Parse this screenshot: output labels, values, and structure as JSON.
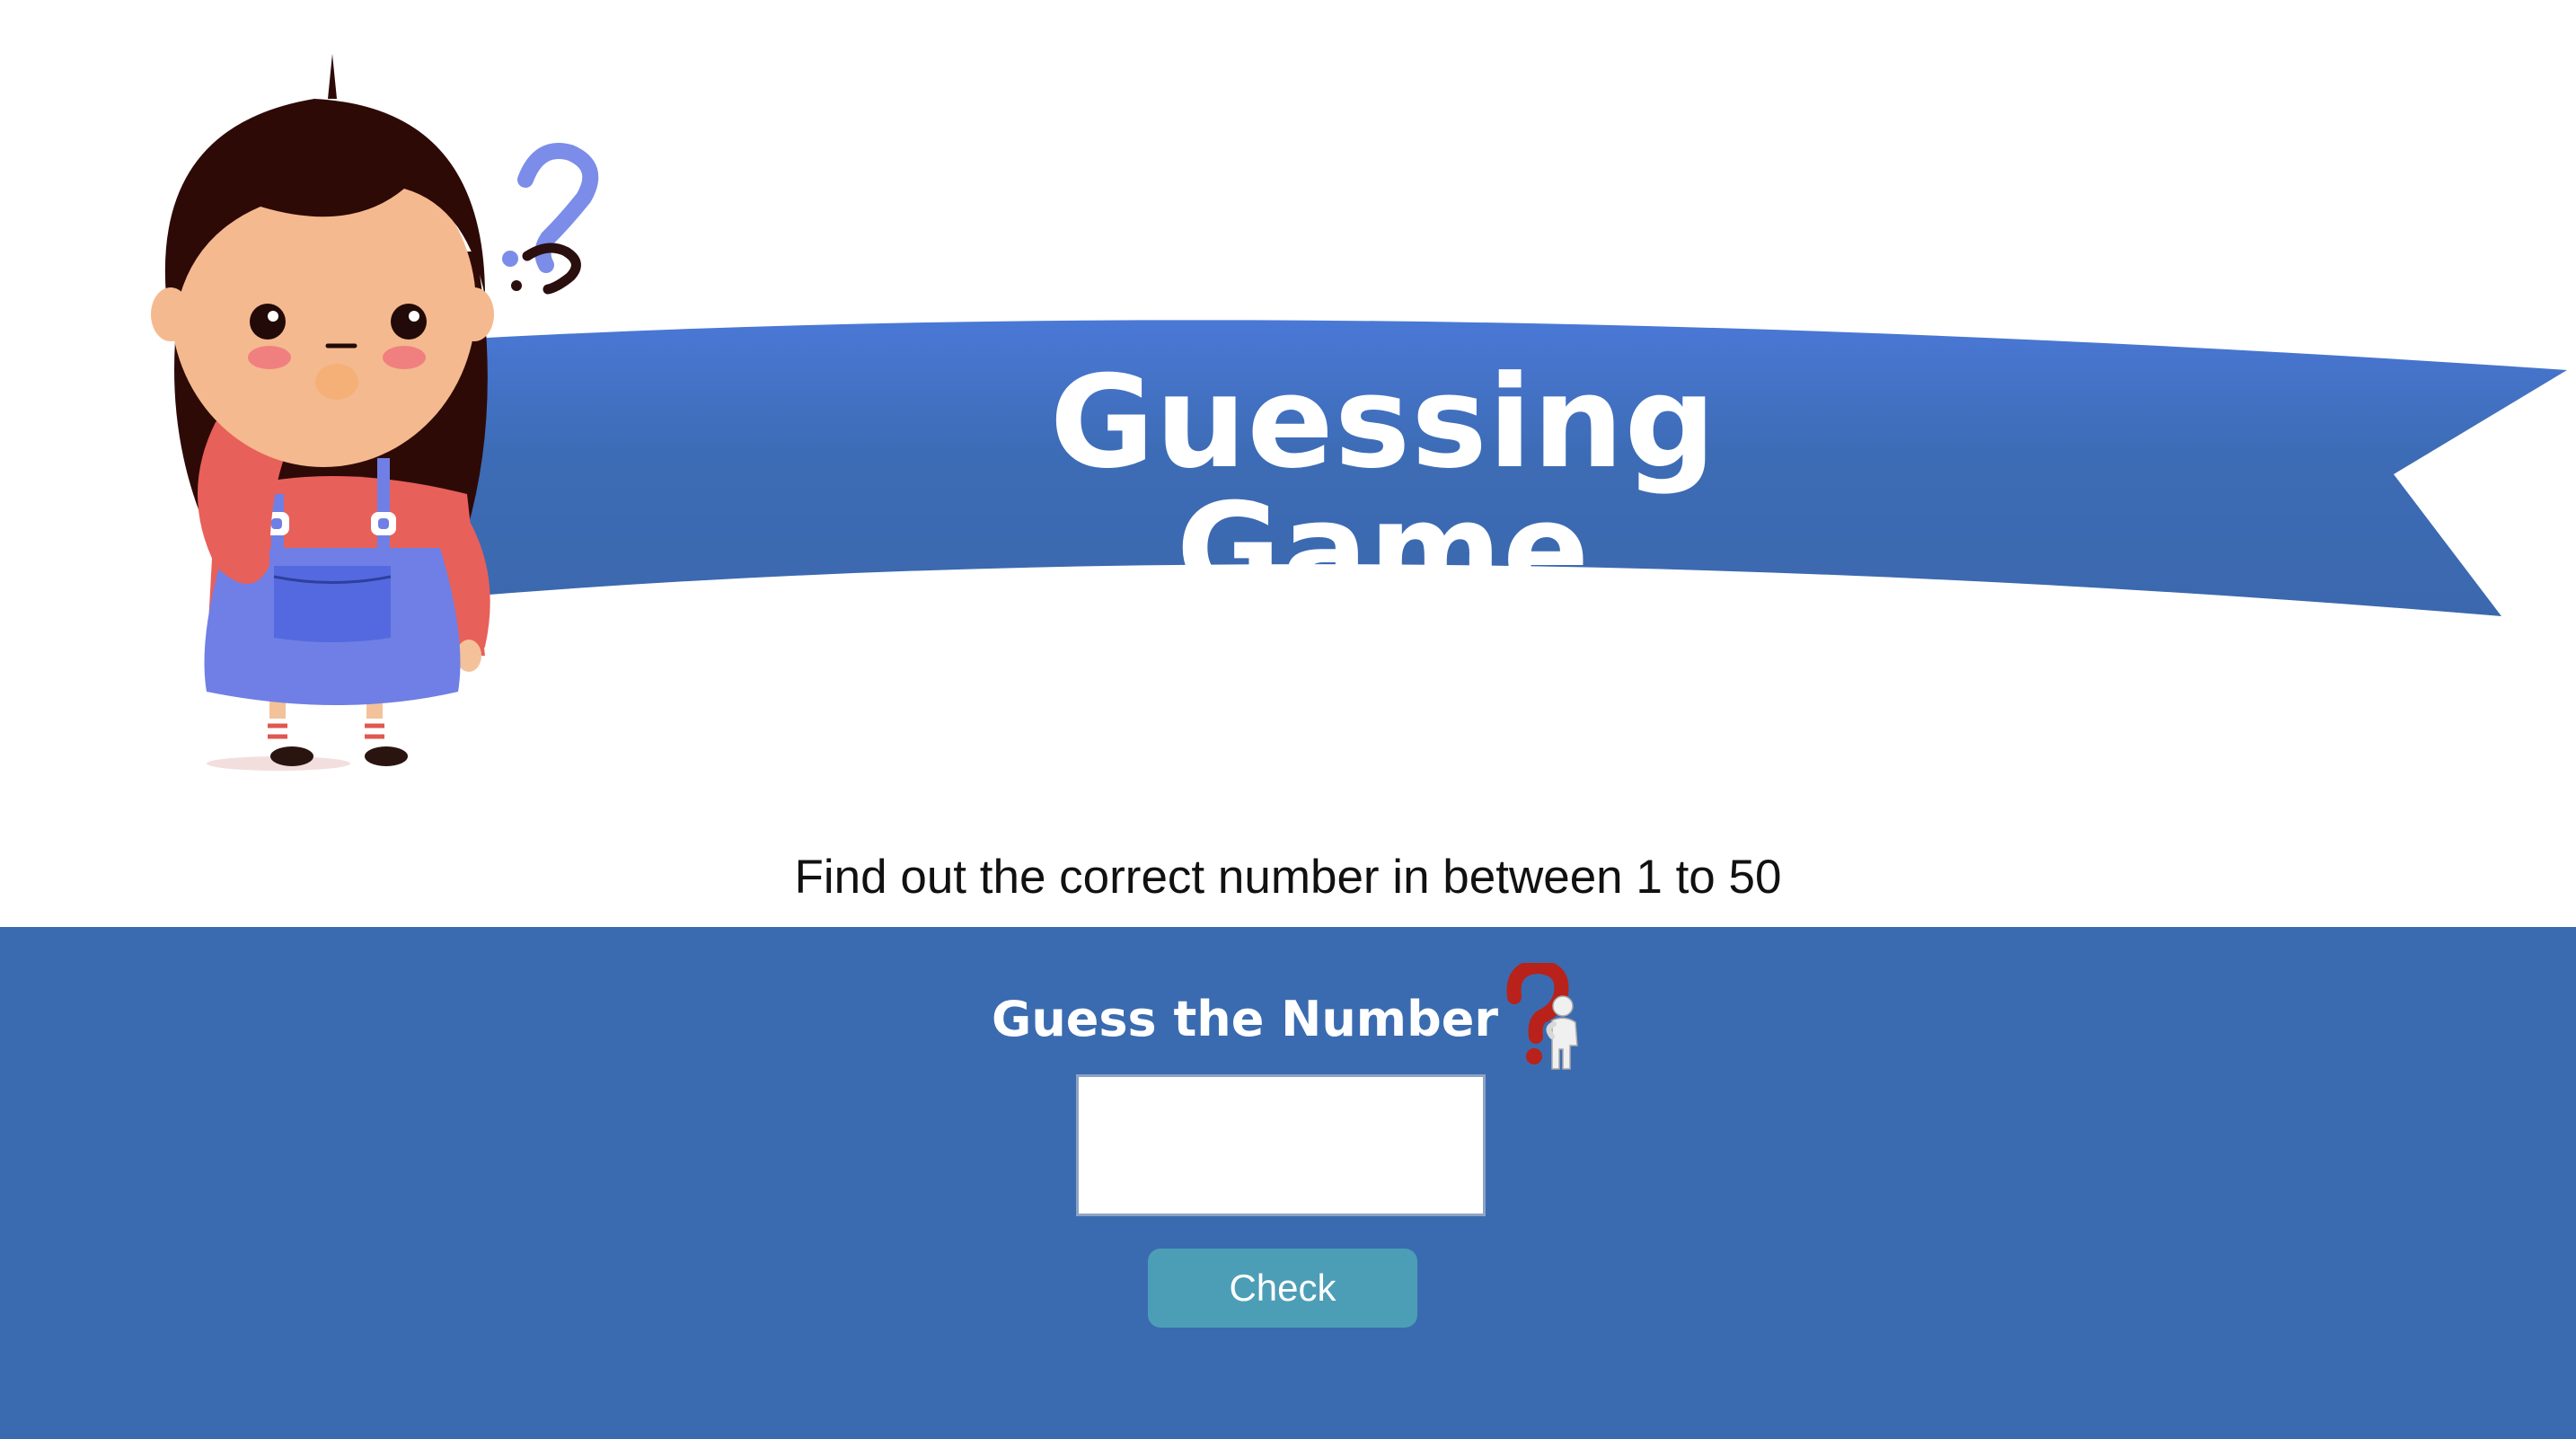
{
  "banner": {
    "title": "Guessing Game"
  },
  "instruction": "Find out the correct number in between 1 to 50",
  "game": {
    "heading": "Guess the Number",
    "heading_icon": "thinking-person-question-mark-icon",
    "input_value": "",
    "check_label": "Check"
  },
  "colors": {
    "banner_blue": "#3f6fbd",
    "panel_blue": "#3a6bb0",
    "button_teal": "#4c9eb6",
    "question_mark_blue": "#7b8de8"
  }
}
